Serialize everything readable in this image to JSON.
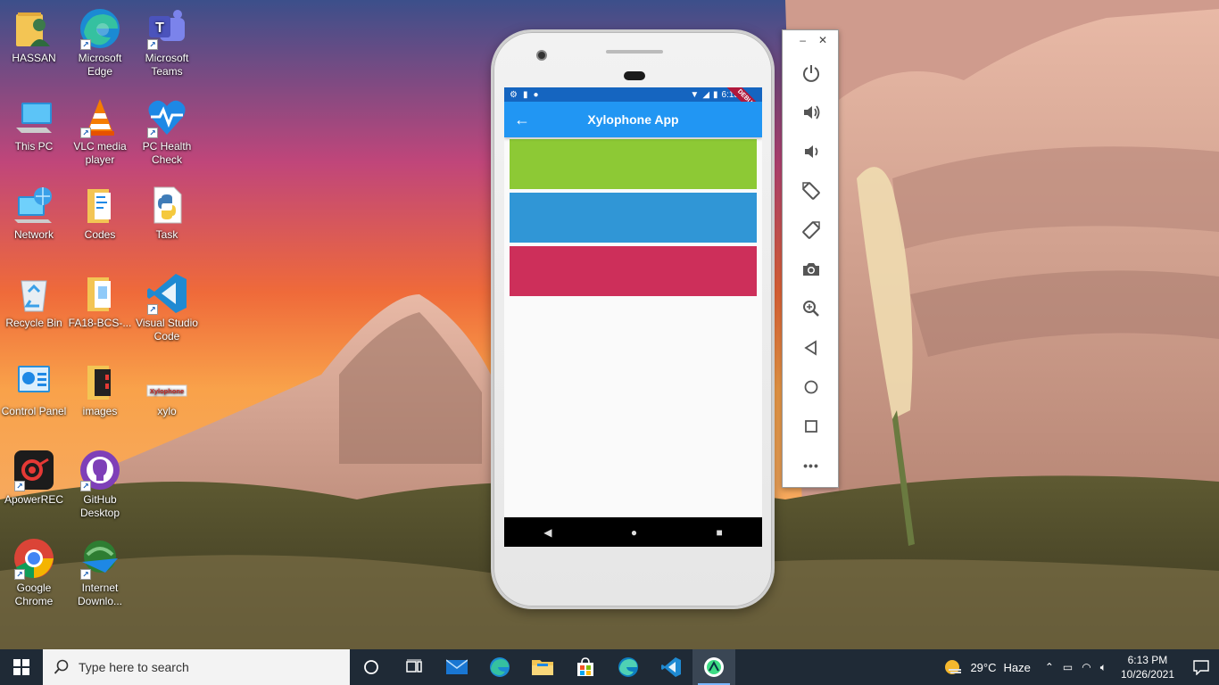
{
  "desktop": {
    "icons": [
      {
        "label": "HASSAN"
      },
      {
        "label": "Microsoft Edge"
      },
      {
        "label": "Microsoft Teams"
      },
      {
        "label": "This PC"
      },
      {
        "label": "VLC media player"
      },
      {
        "label": "PC Health Check"
      },
      {
        "label": "Network"
      },
      {
        "label": "Codes"
      },
      {
        "label": "Task"
      },
      {
        "label": "Recycle Bin"
      },
      {
        "label": "FA18-BCS-..."
      },
      {
        "label": "Visual Studio Code"
      },
      {
        "label": "Control Panel"
      },
      {
        "label": "images"
      },
      {
        "label": "xylo"
      },
      {
        "label": "ApowerREC"
      },
      {
        "label": "GitHub Desktop"
      },
      {
        "label": "Google Chrome"
      },
      {
        "label": "Internet Downlo..."
      }
    ],
    "xylo_thumb_text": "Xylophone"
  },
  "emulator": {
    "status_time": "6:13",
    "debug_label": "DEBUG",
    "app_title": "Xylophone App",
    "back_icon": "arrow-left-icon",
    "keys": [
      {
        "color": "#8dc935"
      },
      {
        "color": "#3096d6"
      },
      {
        "color": "#cd2f5a"
      }
    ],
    "nav": {
      "back": "◀",
      "home": "●",
      "recents": "■"
    }
  },
  "emulator_toolbar": {
    "minimize": "–",
    "close": "✕",
    "buttons": [
      "power-icon",
      "volume-up-icon",
      "volume-down-icon",
      "rotate-left-icon",
      "rotate-right-icon",
      "camera-icon",
      "zoom-icon",
      "back-icon",
      "home-icon",
      "overview-icon",
      "more-icon"
    ],
    "more_label": "•••"
  },
  "taskbar": {
    "search_placeholder": "Type here to search",
    "apps": [
      "task-view",
      "mail",
      "edge",
      "file-explorer",
      "store",
      "edge-dev",
      "vscode",
      "android-studio"
    ],
    "weather": {
      "temp": "29°C",
      "condition": "Haze"
    },
    "clock": {
      "time": "6:13 PM",
      "date": "10/26/2021"
    }
  }
}
